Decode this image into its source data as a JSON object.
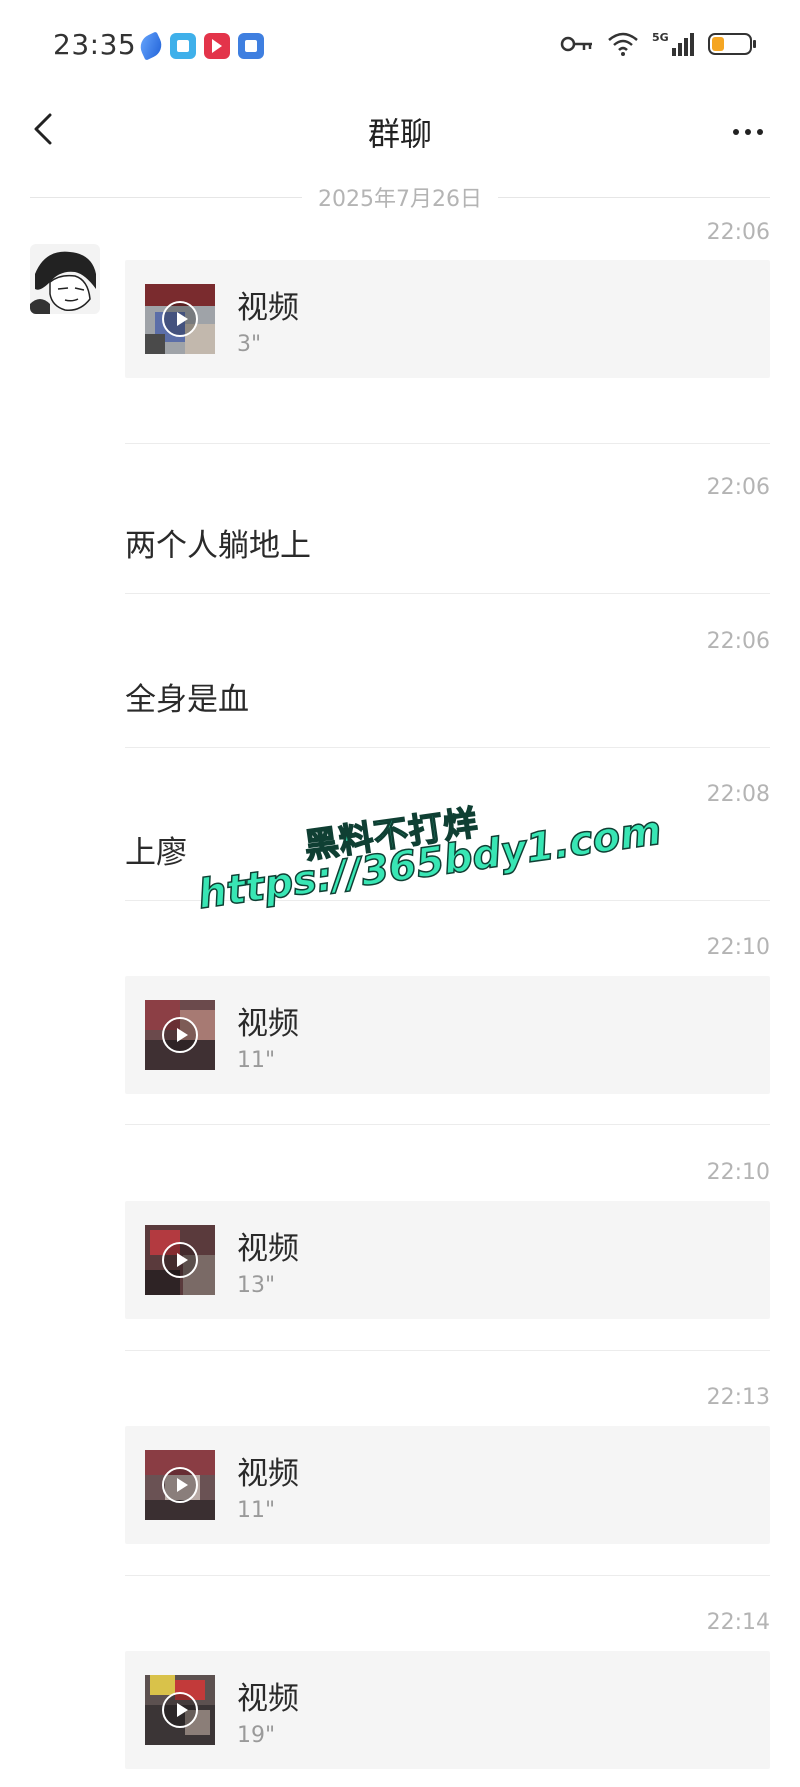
{
  "status_bar": {
    "time": "23:35",
    "network": "5G",
    "battery_level": 0.3,
    "app_icons": [
      "feather-app-icon",
      "book-app-icon",
      "video-app-icon",
      "blue-app-icon"
    ],
    "icons": [
      "vpn-key-icon",
      "wifi-icon",
      "signal-icon",
      "battery-icon"
    ]
  },
  "header": {
    "title": "群聊",
    "back_icon": "chevron-left-icon",
    "more_icon": "more-dots-icon"
  },
  "date_divider": "2025年7月26日",
  "messages": [
    {
      "time": "22:06",
      "type": "video",
      "label": "视频",
      "duration": "3\""
    },
    {
      "time": "22:06",
      "type": "text",
      "text": "两个人躺地上"
    },
    {
      "time": "22:06",
      "type": "text",
      "text": "全身是血"
    },
    {
      "time": "22:08",
      "type": "text",
      "text": "上廖"
    },
    {
      "time": "22:10",
      "type": "video",
      "label": "视频",
      "duration": "11\""
    },
    {
      "time": "22:10",
      "type": "video",
      "label": "视频",
      "duration": "13\""
    },
    {
      "time": "22:13",
      "type": "video",
      "label": "视频",
      "duration": "11\""
    },
    {
      "time": "22:14",
      "type": "video",
      "label": "视频",
      "duration": "19\""
    }
  ],
  "watermark": {
    "line1": "黑料不打烊",
    "line2": "https://365bdy1.com"
  },
  "colors": {
    "timestamp": "#b4b4b4",
    "video_card_bg": "#f5f5f5",
    "watermark_fill": "#38e6b4"
  }
}
